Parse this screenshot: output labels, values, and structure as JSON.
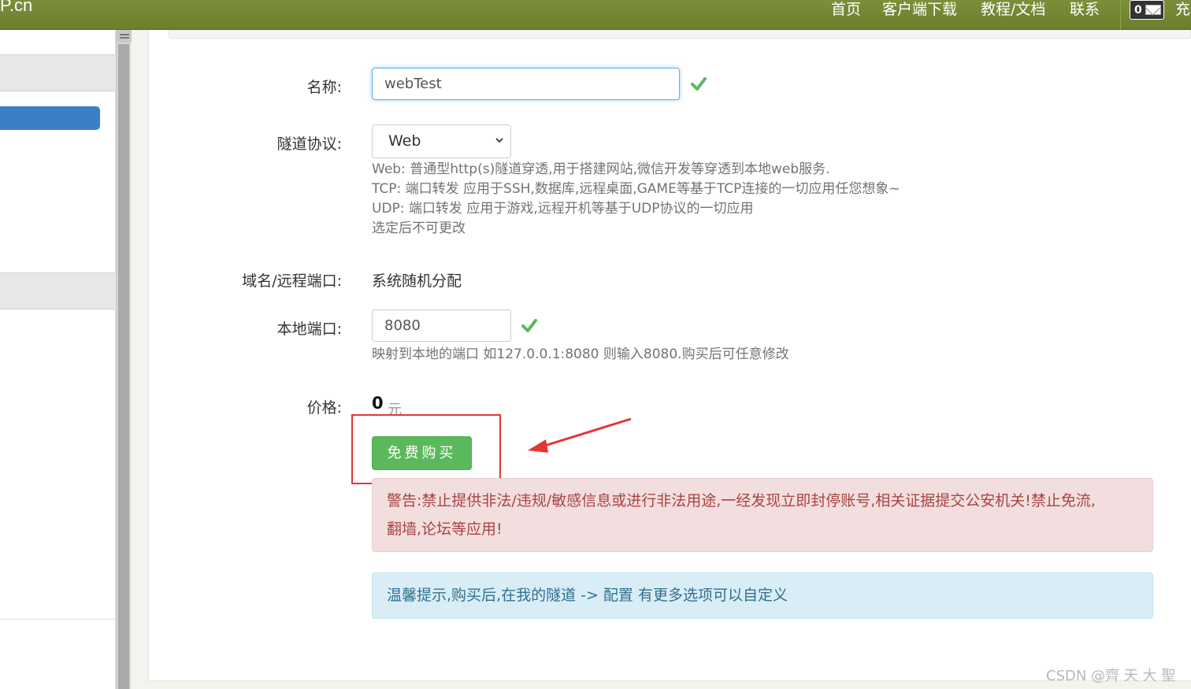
{
  "navbar": {
    "brand": "P.cn",
    "items": [
      "首页",
      "客户端下载",
      "教程/文档",
      "联系"
    ],
    "message_count": "0",
    "trailing": "充"
  },
  "form": {
    "name_label": "名称:",
    "name_value": "webTest",
    "protocol_label": "隧道协议:",
    "protocol_value": "Web",
    "protocol_help": [
      "Web: 普通型http(s)隧道穿透,用于搭建网站,微信开发等穿透到本地web服务.",
      "TCP: 端口转发 应用于SSH,数据库,远程桌面,GAME等基于TCP连接的一切应用任您想象~",
      "UDP: 端口转发 应用于游戏,远程开机等基于UDP协议的一切应用",
      "选定后不可更改"
    ],
    "domain_label": "域名/远程端口:",
    "domain_value": "系统随机分配",
    "local_port_label": "本地端口:",
    "local_port_value": "8080",
    "local_port_help": "映射到本地的端口 如127.0.0.1:8080 则输入8080.购买后可任意修改",
    "price_label": "价格:",
    "price_value": "0",
    "price_unit": "元",
    "buy_label": "免费购买"
  },
  "alerts": {
    "warning_line1": "警告:禁止提供非法/违规/敏感信息或进行非法用途,一经发现立即封停账号,相关证据提交公安机关!禁止免流,",
    "warning_line2": "翻墙,论坛等应用!",
    "info": "温馨提示,购买后,在我的隧道 -> 配置 有更多选项可以自定义"
  },
  "watermark": "CSDN @齊 天 大 聖",
  "colors": {
    "navbar": "#6c7f2e",
    "success": "#5cb85c",
    "highlight": "#e53535",
    "sidebar_active": "#3a80c7"
  }
}
